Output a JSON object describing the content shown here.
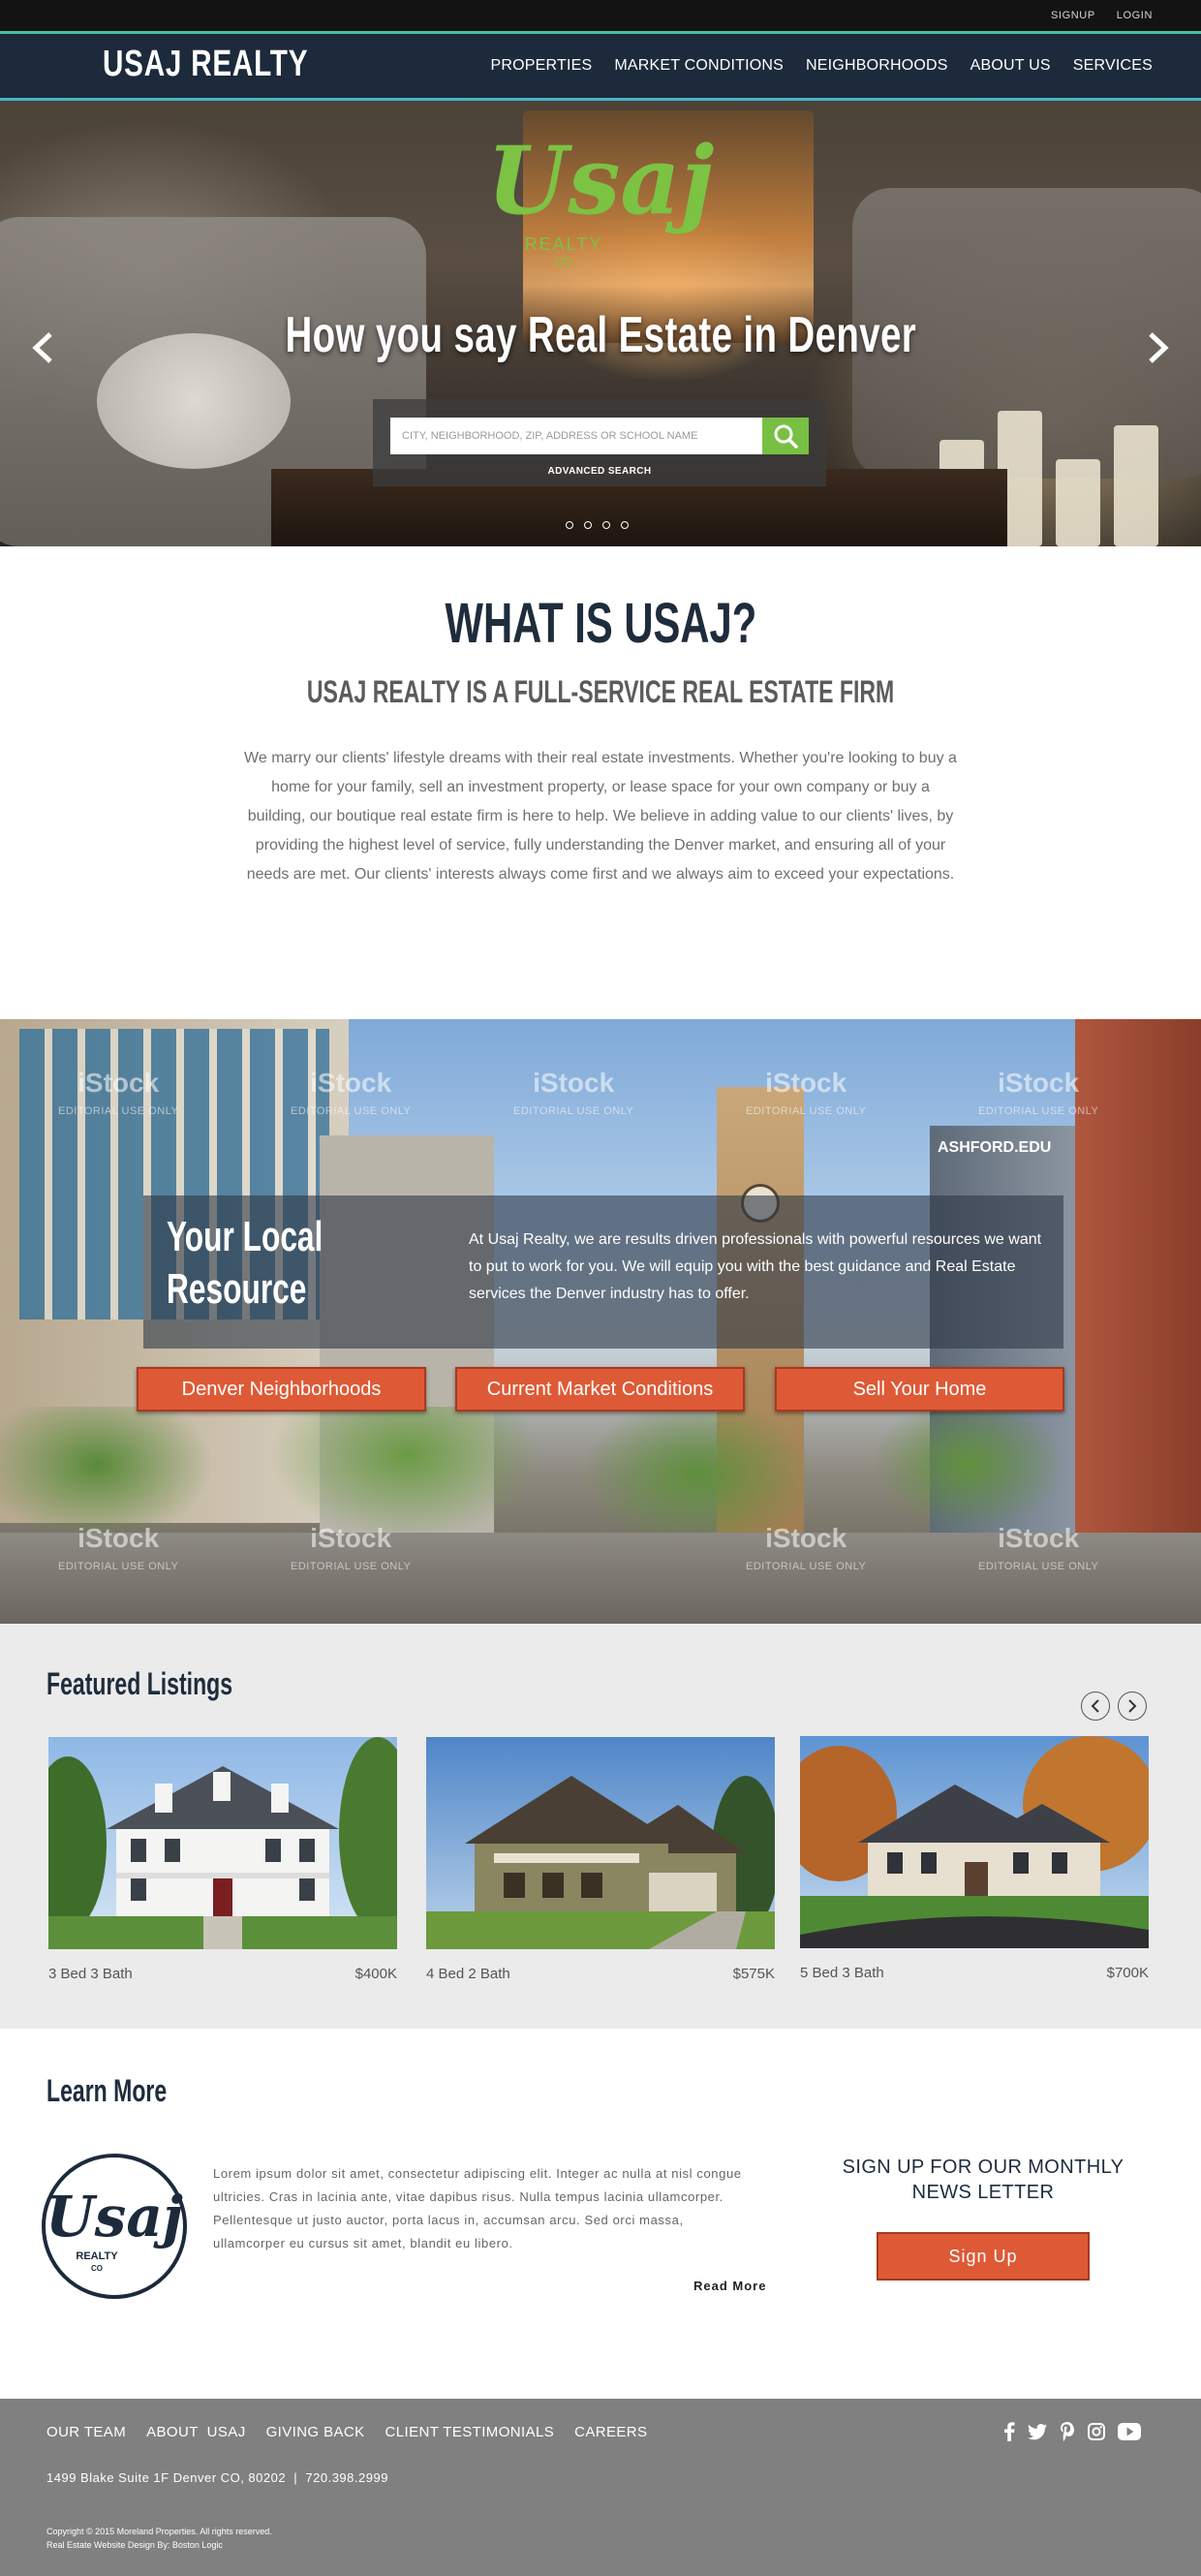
{
  "topbar": {
    "signup": "SIGNUP",
    "login": "LOGIN"
  },
  "header": {
    "brand": "USAJ REALTY",
    "nav": [
      "PROPERTIES",
      "MARKET CONDITIONS",
      "NEIGHBORHOODS",
      "ABOUT US",
      "SERVICES"
    ]
  },
  "hero": {
    "logo_word": "Usaj",
    "logo_sub1": "REALTY",
    "logo_sub2": "CO",
    "title": "How you say Real Estate in Denver",
    "search_placeholder": "CITY, NEIGHBORHOOD, ZIP, ADDRESS OR SCHOOL NAME",
    "advanced_search": "ADVANCED SEARCH",
    "slide_count": 4,
    "active_slide": 0
  },
  "about": {
    "title": "WHAT IS USAJ?",
    "subtitle": "USAJ REALTY IS A FULL-SERVICE REAL ESTATE FIRM",
    "body": "We marry our clients' lifestyle dreams with their real estate investments. Whether you're looking to buy a home for your family, sell an investment property, or lease space for your own company or buy a building, our boutique real estate firm is here to help. We believe in adding value to our clients' lives, by providing the highest level of service, fully understanding the Denver market, and ensuring all of your needs are met. Our clients' interests always come first and we always aim to exceed your expectations."
  },
  "resource": {
    "title_line1": "Your Local",
    "title_line2": "Resource",
    "text": "At Usaj Realty, we are results driven professionals with powerful resources we want to put to work for you. We will equip you with the best guidance and Real Estate services the Denver industry has to offer.",
    "buttons": [
      "Denver Neighborhoods",
      "Current Market Conditions",
      "Sell Your Home"
    ],
    "watermark_brand": "iStock",
    "watermark_text": "EDITORIAL USE ONLY",
    "sign_text": "ASHFORD.EDU"
  },
  "featured": {
    "title": "Featured Listings",
    "listings": [
      {
        "beds_baths": "3 Bed 3 Bath",
        "price": "$400K"
      },
      {
        "beds_baths": "4 Bed 2 Bath",
        "price": "$575K"
      },
      {
        "beds_baths": "5 Bed 3 Bath",
        "price": "$700K"
      }
    ]
  },
  "learn": {
    "title": "Learn More",
    "logo_word": "Usaj",
    "logo_sub1": "REALTY",
    "logo_sub2": "CO",
    "body": "Lorem ipsum dolor sit amet, consectetur adipiscing elit. Integer ac nulla at nisl congue ultricies. Cras in lacinia ante, vitae dapibus risus. Nulla tempus lacinia ullamcorper.  Pellentesque ut justo auctor, porta lacus in, accumsan arcu. Sed orci massa, ullamcorper eu cursus sit amet, blandit eu libero.",
    "read_more": "Read More",
    "newsletter_title": "SIGN UP FOR OUR MONTHLY NEWS LETTER",
    "signup_label": "Sign Up"
  },
  "footer": {
    "links": [
      "OUR TEAM",
      "ABOUT  USAJ",
      "GIVING BACK",
      "CLIENT TESTIMONIALS",
      "CAREERS"
    ],
    "address": "1499 Blake Suite 1F Denver CO, 80202  |  720.398.2999",
    "copyright": "Copyright © 2015 Moreland Properties. All rights reserved.",
    "credit": "Real Estate Website Design By: Boston Logic",
    "social": [
      "facebook-icon",
      "twitter-icon",
      "pinterest-icon",
      "instagram-icon",
      "youtube-icon"
    ]
  },
  "colors": {
    "navy": "#1c2a3b",
    "accent_green": "#78c043",
    "accent_orange": "#de5a36",
    "footer_gray": "#808080"
  }
}
